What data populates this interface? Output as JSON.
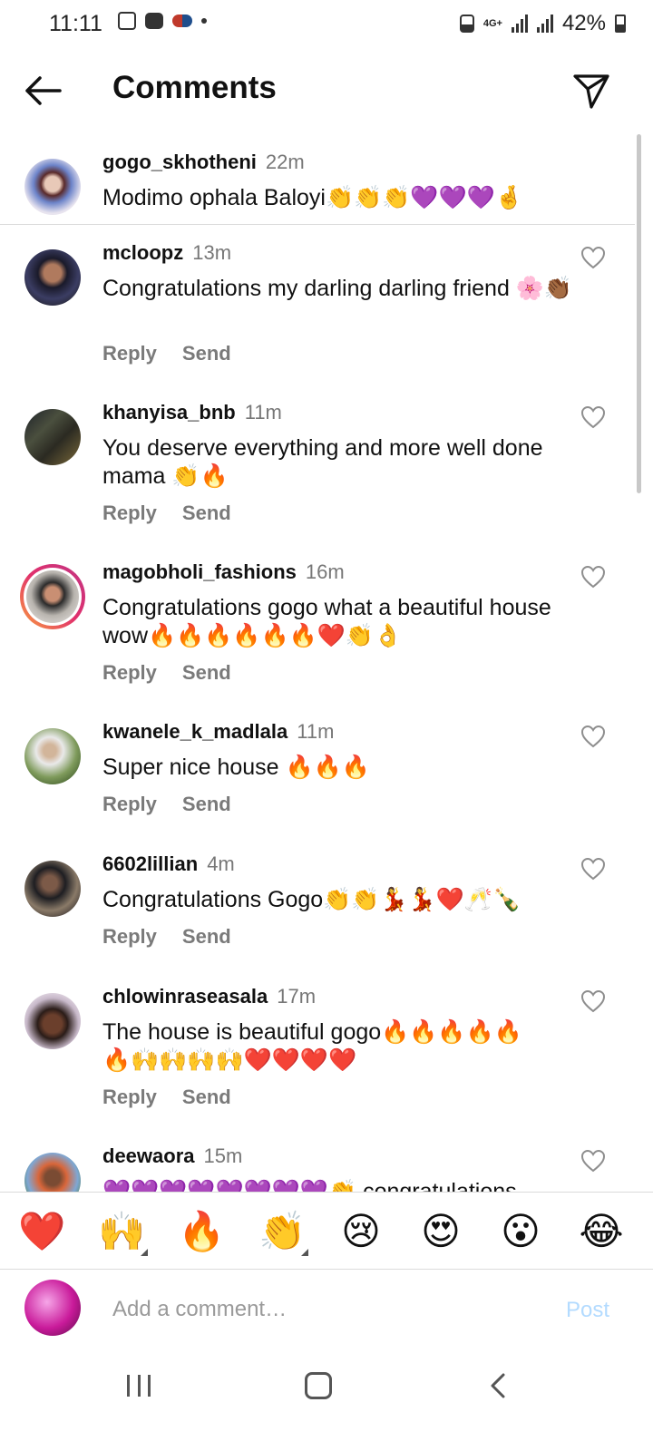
{
  "status_bar": {
    "time": "11:11",
    "network": "4G+",
    "battery": "42%"
  },
  "header": {
    "title": "Comments"
  },
  "caption": {
    "username": "gogo_skhotheni",
    "time": "22m",
    "text": "Modimo ophala Baloyi👏👏👏💜💜💜🤞"
  },
  "comments": [
    {
      "username": "mcloopz",
      "time": "13m",
      "text": "Congratulations my darling darling friend 🌸👏🏾"
    },
    {
      "username": "khanyisa_bnb",
      "time": "11m",
      "text": "You deserve everything and more well done mama 👏🔥"
    },
    {
      "username": "magobholi_fashions",
      "time": "16m",
      "text": "Congratulations gogo what a beautiful house wow🔥🔥🔥🔥🔥🔥❤️👏👌"
    },
    {
      "username": "kwanele_k_madlala",
      "time": "11m",
      "text": "Super nice house 🔥🔥🔥"
    },
    {
      "username": "6602lillian",
      "time": "4m",
      "text": "Congratulations Gogo👏👏💃💃❤️🥂🍾"
    },
    {
      "username": "chlowinraseasala",
      "time": "17m",
      "text": "The house is beautiful gogo🔥🔥🔥🔥🔥🔥🙌🙌🙌🙌❤️❤️❤️❤️"
    },
    {
      "username": "deewaora",
      "time": "15m",
      "text": "💜💜💜💜💜💜💜💜👏 congratulations"
    }
  ],
  "actions": {
    "reply_label": "Reply",
    "send_label": "Send"
  },
  "emoji_bar": [
    "❤️",
    "🙌",
    "🔥",
    "👏",
    "😢",
    "😍",
    "😮",
    "😂"
  ],
  "compose": {
    "placeholder": "Add a comment…",
    "post_label": "Post"
  },
  "colors": {
    "post_disabled": "#b3dbff",
    "story_ring_start": "#f9a03f",
    "story_ring_end": "#c13584"
  }
}
